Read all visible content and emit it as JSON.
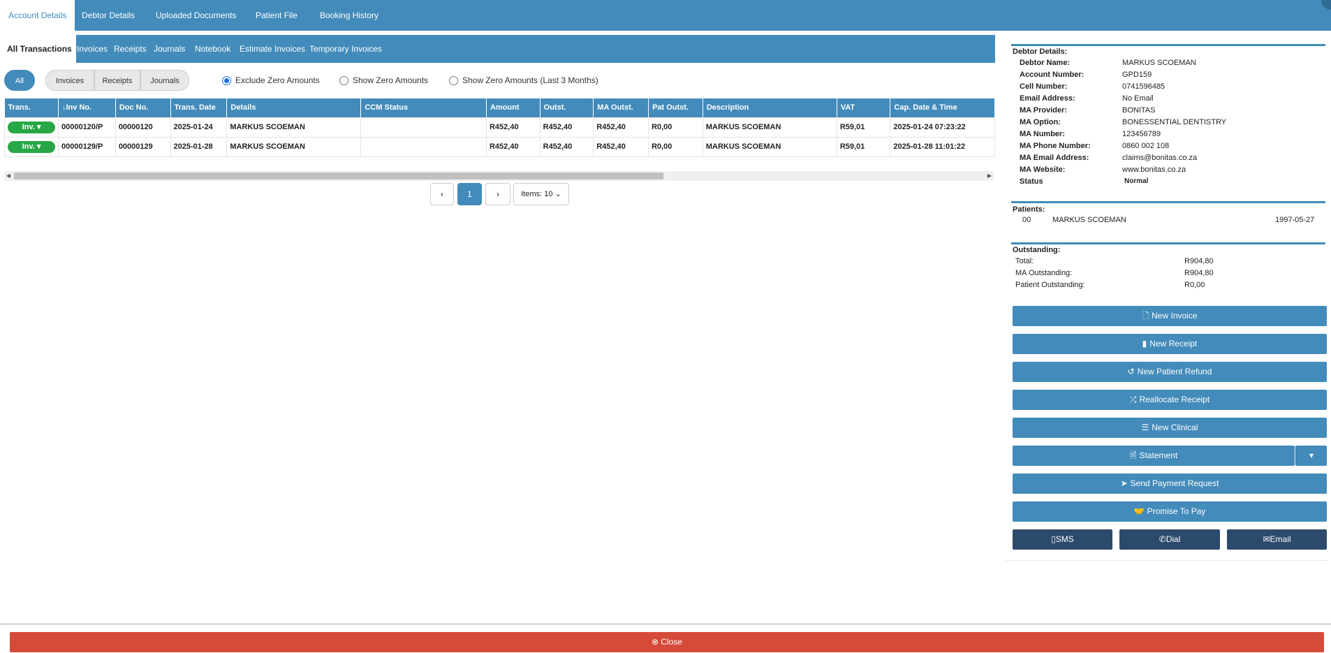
{
  "top_tabs": [
    "Account Details",
    "Debtor Details",
    "Uploaded Documents",
    "Patient File",
    "Booking History"
  ],
  "sub_tabs": [
    "All Transactions",
    "Invoices",
    "Receipts",
    "Journals",
    "Notebook",
    "Estimate Invoices",
    "Temporary Invoices"
  ],
  "filters": {
    "all": "All",
    "invoices": "Invoices",
    "receipts": "Receipts",
    "journals": "Journals",
    "radio_exclude": "Exclude Zero Amounts",
    "radio_show": "Show Zero Amounts",
    "radio_show3": "Show Zero Amounts (Last 3 Months)",
    "selected_radio": "Exclude Zero Amounts"
  },
  "table": {
    "headers": [
      "Trans.",
      "Inv No.",
      "Doc No.",
      "Trans. Date",
      "Details",
      "CCM Status",
      "Amount",
      "Outst.",
      "MA Outst.",
      "Pat Outst.",
      "Description",
      "VAT",
      "Cap. Date & Time"
    ],
    "rows": [
      {
        "trans": "Inv.",
        "inv_no": "00000120/P",
        "doc_no": "00000120",
        "date": "2025-01-24",
        "details": "MARKUS SCOEMAN",
        "ccm": "",
        "amount": "R452,40",
        "outst": "R452,40",
        "ma_outst": "R452,40",
        "pat_outst": "R0,00",
        "description": "MARKUS SCOEMAN",
        "vat": "R59,01",
        "cap": "2025-01-24 07:23:22"
      },
      {
        "trans": "Inv.",
        "inv_no": "00000129/P",
        "doc_no": "00000129",
        "date": "2025-01-28",
        "details": "MARKUS SCOEMAN",
        "ccm": "",
        "amount": "R452,40",
        "outst": "R452,40",
        "ma_outst": "R452,40",
        "pat_outst": "R0,00",
        "description": "MARKUS SCOEMAN",
        "vat": "R59,01",
        "cap": "2025-01-28 11:01:22"
      }
    ]
  },
  "pagination": {
    "current": "1",
    "items": "Items: 10"
  },
  "debtor": {
    "title": "Debtor Details:",
    "fields": [
      {
        "k": "Debtor Name:",
        "v": "MARKUS SCOEMAN"
      },
      {
        "k": "Account Number:",
        "v": "GPD159"
      },
      {
        "k": "Cell Number:",
        "v": "0741596485"
      },
      {
        "k": "Email Address:",
        "v": "No Email"
      },
      {
        "k": "MA Provider:",
        "v": "BONITAS"
      },
      {
        "k": "MA Option:",
        "v": "BONESSENTIAL DENTISTRY"
      },
      {
        "k": "MA Number:",
        "v": "123456789"
      },
      {
        "k": "MA Phone Number:",
        "v": "0860 002 108"
      },
      {
        "k": "MA Email Address:",
        "v": "claims@bonitas.co.za"
      },
      {
        "k": "MA Website:",
        "v": "www.bonitas.co.za"
      },
      {
        "k": "Status",
        "v": "Normal"
      }
    ]
  },
  "patients": {
    "title": "Patients:",
    "rows": [
      {
        "code": "00",
        "name": "MARKUS SCOEMAN",
        "dob": "1997-05-27"
      }
    ]
  },
  "outstanding": {
    "title": "Outstanding:",
    "rows": [
      {
        "k": "Total:",
        "v": "R904,80"
      },
      {
        "k": "MA Outstanding:",
        "v": "R904,80"
      },
      {
        "k": "Patient Outstanding:",
        "v": "R0,00"
      }
    ]
  },
  "actions": [
    "New Invoice",
    "New Receipt",
    "New Patient Refund",
    "Reallocate Receipt",
    "New Clinical",
    "Statement",
    "Send Payment Request",
    "Promise To Pay"
  ],
  "contact": [
    "SMS",
    "Dial",
    "Email"
  ],
  "close_label": "Close",
  "colors": {
    "primary": "#428bba",
    "success": "#27a745",
    "danger": "#d64a3a",
    "dark": "#2c4a6b"
  }
}
